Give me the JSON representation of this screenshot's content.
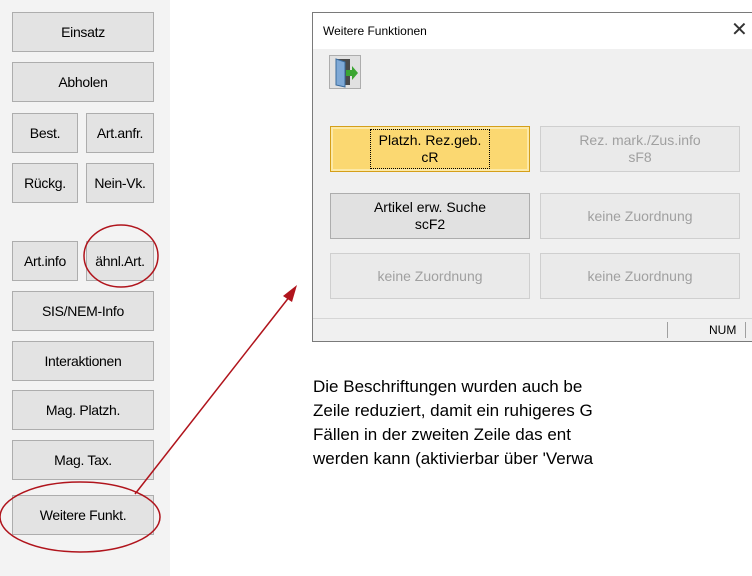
{
  "sidebar": {
    "buttons": {
      "einsatz": "Einsatz",
      "abholen": "Abholen",
      "best": "Best.",
      "artanfr": "Art.anfr.",
      "rueckg": "Rückg.",
      "neinvk": "Nein-Vk.",
      "artinfo": "Art.info",
      "aehnlart": "ähnl.Art.",
      "sisnem": "SIS/NEM-Info",
      "interaktionen": "Interaktionen",
      "magplatzh": "Mag. Platzh.",
      "magtax": "Mag. Tax.",
      "weiterefunkt": "Weitere Funkt."
    }
  },
  "dialog": {
    "title": "Weitere Funktionen",
    "close_icon": "close-icon",
    "exit_icon": "exit-door-icon",
    "buttons": [
      {
        "line1": "Platzh. Rez.geb.",
        "line2": "cR",
        "state": "active"
      },
      {
        "line1": "Rez. mark./Zus.info",
        "line2": "sF8",
        "state": "disabled"
      },
      {
        "line1": "Artikel erw. Suche",
        "line2": "scF2",
        "state": "enabled"
      },
      {
        "line1": "keine Zuordnung",
        "line2": "",
        "state": "disabled"
      },
      {
        "line1": "keine Zuordnung",
        "line2": "",
        "state": "disabled"
      },
      {
        "line1": "keine Zuordnung",
        "line2": "",
        "state": "disabled"
      }
    ],
    "statusbar": {
      "num": "NUM"
    }
  },
  "caption": {
    "line1": "Die Beschriftungen wurden auch be",
    "line2": "Zeile reduziert, damit ein ruhigeres G",
    "line3": "Fällen in der zweiten Zeile das ent",
    "line4": "werden kann (aktivierbar über 'Verwa"
  },
  "colors": {
    "annotation": "#b0141c",
    "active_button": "#fbd871"
  }
}
